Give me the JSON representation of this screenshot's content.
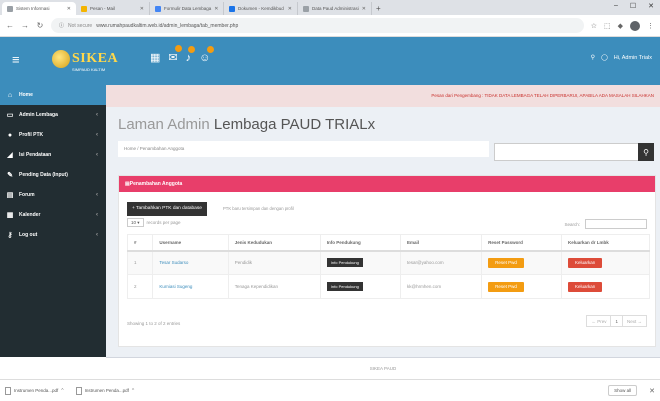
{
  "browser": {
    "tabs": [
      {
        "title": "Sistem Informasi",
        "active": true
      },
      {
        "title": "Pesan - Mail",
        "active": false
      },
      {
        "title": "Formulir Data Lembaga",
        "active": false
      },
      {
        "title": "Dokumen - Kemdikbud",
        "active": false
      },
      {
        "title": "Data Paud Administrasi",
        "active": false
      }
    ],
    "url_info": "Not secure",
    "url": "www.rumahpaudkaltim.web.id/admin_lembaga/tab_member.php",
    "window_controls": [
      "–",
      "☐",
      "✕"
    ]
  },
  "header": {
    "logo_text": "SIKEA",
    "logo_sub": "SIMPAUD KALTIM",
    "user": "Hi, Admin Trialx",
    "icons": [
      "grid-icon",
      "mail-icon",
      "bell-icon",
      "chat-icon"
    ]
  },
  "sidebar": {
    "items": [
      {
        "label": "Home",
        "icon": "home-icon",
        "active": true,
        "caret": false
      },
      {
        "label": "Admin Lembaga",
        "icon": "monitor-icon",
        "active": false,
        "caret": true
      },
      {
        "label": "Profil PTK",
        "icon": "user-icon",
        "active": false,
        "caret": true
      },
      {
        "label": "Isi Pendataan",
        "icon": "chart-icon",
        "active": false,
        "caret": true
      },
      {
        "label": "Pending Data (Input)",
        "icon": "pencil-icon",
        "active": false,
        "caret": false
      },
      {
        "label": "Forum",
        "icon": "forum-icon",
        "active": false,
        "caret": true
      },
      {
        "label": "Kalender",
        "icon": "calendar-icon",
        "active": false,
        "caret": true
      },
      {
        "label": "Log out",
        "icon": "key-icon",
        "active": false,
        "caret": true
      }
    ]
  },
  "content": {
    "marquee": "Pesan dari Pengembang : TIDAK DATA LEMBAGA TELAH DIPERBARUI, APABILA ADA MASALAH SILAHKAN",
    "title_light": "Laman Admin",
    "title_dark": "Lembaga PAUD TRIALx",
    "breadcrumb": "Home  /  Penambahan Anggota",
    "search_placeholder": "",
    "box_title": "Penambahan Anggota",
    "add_button": "+ Tambahkan PTK dan database",
    "add_note": "PTK baru tersimpan dan dengan profil",
    "length_value": "10",
    "length_label": "records per page",
    "table_search_label": "Search:",
    "columns": [
      "#",
      "Username",
      "Jenis Kedudukan",
      "Info Pendukung",
      "Email",
      "Reset Password",
      "Keluarkan dr Lmbk"
    ],
    "rows": [
      {
        "no": "1",
        "username": "Tesar Sudarso",
        "jenis": "Pendidik",
        "info": "Info Pendukung",
        "email": "tesar@yahoo.com",
        "reset": "Reset Pwd",
        "keluar": "Keluarkan"
      },
      {
        "no": "2",
        "username": "Kurniasi Sugeng",
        "jenis": "Tenaga Kependidikan",
        "info": "Info Pendukung",
        "email": "kk@hrmhen.com",
        "reset": "Reset Pwd",
        "keluar": "Keluarkan"
      }
    ],
    "table_info": "Showing 1 to 2 of 2 entries",
    "pager": {
      "prev": "← Prev",
      "current": "1",
      "next": "Next →"
    },
    "footer": "SIKEA PAUD"
  },
  "downloads": {
    "items": [
      "Instrumen Penda...pdf",
      "Instrumen Penda...pdf"
    ],
    "show_all": "Show all"
  }
}
